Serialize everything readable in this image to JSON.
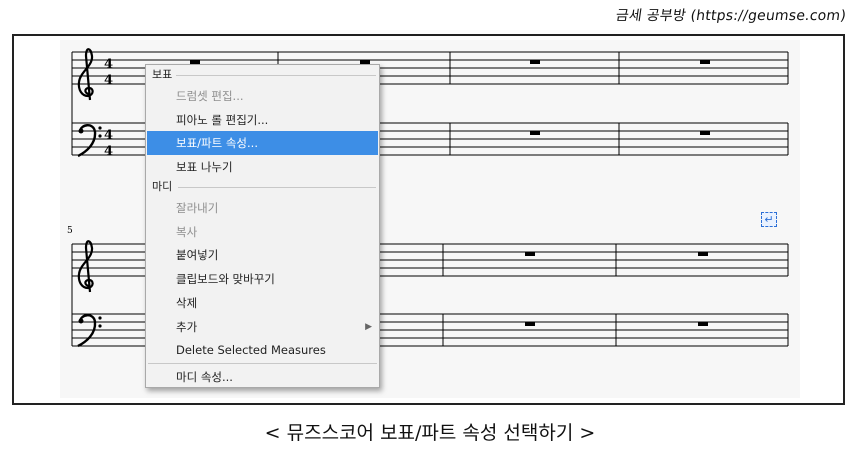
{
  "watermark": "금세 공부방 (https://geumse.com)",
  "caption": "< 뮤즈스코어 보표/파트 속성 선택하기 >",
  "score": {
    "time_signature_top": "4",
    "time_signature_bottom": "4",
    "second_system_measure_number": "5"
  },
  "context_menu": {
    "section_staff": "보표",
    "staff_items": [
      {
        "label": "드럼셋 편집...",
        "enabled": false
      },
      {
        "label": "피아노 롤 편집기...",
        "enabled": true
      },
      {
        "label": "보표/파트 속성...",
        "enabled": true,
        "highlighted": true
      },
      {
        "label": "보표 나누기",
        "enabled": true
      }
    ],
    "section_measure": "마디",
    "measure_items": [
      {
        "label": "잘라내기",
        "enabled": false
      },
      {
        "label": "복사",
        "enabled": false
      },
      {
        "label": "붙여넣기",
        "enabled": true
      },
      {
        "label": "클립보드와 맞바꾸기",
        "enabled": true
      },
      {
        "label": "삭제",
        "enabled": true
      },
      {
        "label": "추가",
        "enabled": true,
        "submenu": true
      },
      {
        "label": "Delete Selected Measures",
        "enabled": true
      }
    ],
    "bottom_item": {
      "label": "마디 속성...",
      "enabled": true
    }
  },
  "colors": {
    "highlight": "#3d8ee6",
    "frame": "#222222",
    "disabled_text": "#8e8e8e",
    "staff_line": "#000000"
  },
  "icons": [
    "treble-clef-icon",
    "bass-clef-icon",
    "whole-rest-icon",
    "submenu-arrow-icon",
    "enter-icon"
  ]
}
